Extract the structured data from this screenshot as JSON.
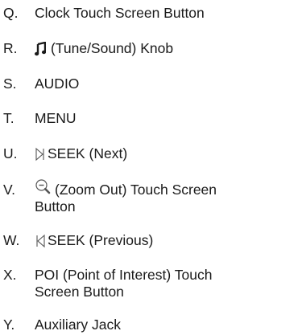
{
  "items": [
    {
      "letter": "Q.",
      "lines": [
        "Clock Touch Screen Button"
      ]
    },
    {
      "letter": "R.",
      "icon": "music-note-icon",
      "lines": [
        "(Tune/Sound) Knob"
      ]
    },
    {
      "letter": "S.",
      "lines": [
        "AUDIO"
      ]
    },
    {
      "letter": "T.",
      "lines": [
        "MENU"
      ]
    },
    {
      "letter": "U.",
      "icon": "seek-next-icon",
      "lines": [
        "SEEK (Next)"
      ]
    },
    {
      "letter": "V.",
      "icon": "zoom-out-icon",
      "lines": [
        "(Zoom Out) Touch Screen",
        "Button"
      ]
    },
    {
      "letter": "W.",
      "icon": "seek-previous-icon",
      "lines": [
        "SEEK (Previous)"
      ]
    },
    {
      "letter": "X.",
      "lines": [
        "POI (Point of Interest) Touch",
        "Screen Button"
      ]
    },
    {
      "letter": "Y.",
      "lines": [
        "Auxiliary Jack"
      ]
    }
  ]
}
